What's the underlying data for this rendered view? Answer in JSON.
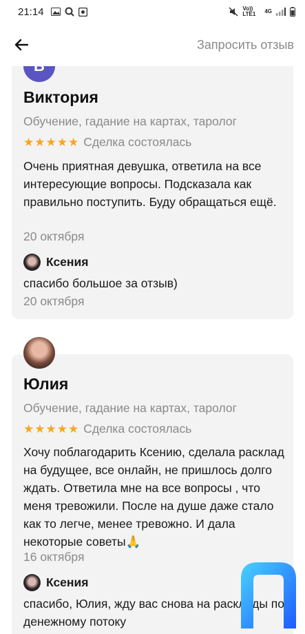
{
  "status_bar": {
    "time": "21:14",
    "network_label": "Vo)) LTE1",
    "net_type": "4G"
  },
  "header": {
    "request_review": "Запросить отзыв"
  },
  "reviews": [
    {
      "avatar_letter": "В",
      "name": "Виктория",
      "category": "Обучение, гадание на картах, таролог",
      "stars": "★★★★★",
      "deal_status": "Сделка состоялась",
      "text": "Очень приятная девушка, ответила на все интересующие вопросы. Подсказала как правильно поступить. Буду обращаться ещё.",
      "date": "20 октября",
      "reply": {
        "name": "Ксения",
        "text": "спасибо большое за отзыв)",
        "date": "20 октября"
      }
    },
    {
      "name": "Юлия",
      "category": "Обучение, гадание на картах, таролог",
      "stars": "★★★★★",
      "deal_status": "Сделка состоялась",
      "text": "Хочу поблагодарить Ксению, сделала расклад на будущее, все онлайн, не пришлось долго ждать. Ответила  мне на все вопросы , что меня тревожили. После на душе даже стало как то легче, менее тревожно. И дала некоторые советы🙏",
      "date": "16 октября",
      "reply": {
        "name": "Ксения",
        "text": "спасибо, Юлия, жду вас снова на расклады по денежному потоку"
      }
    }
  ],
  "colors": {
    "star": "#f5a623",
    "card_bg": "#f3f3f3",
    "avatar_letter_bg": "#5a55c2",
    "muted_text": "#8a8a8a",
    "logo_blue": "#1e6bff"
  }
}
